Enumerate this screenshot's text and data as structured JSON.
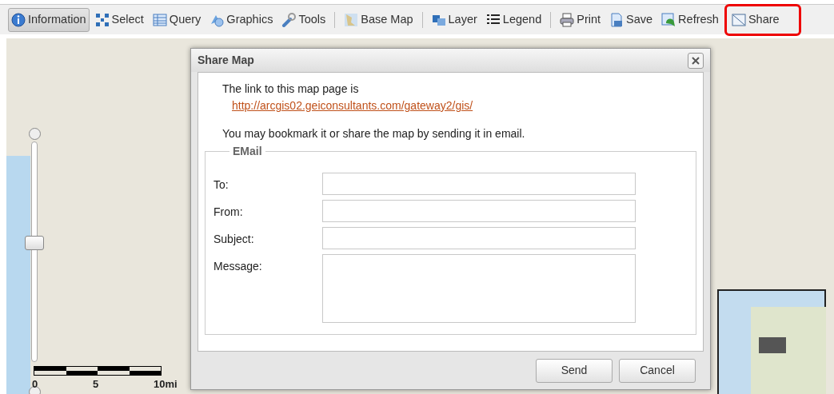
{
  "toolbar": [
    {
      "kind": "tool",
      "label": "Information",
      "selected": true
    },
    {
      "kind": "tool",
      "label": "Select",
      "selected": false
    },
    {
      "kind": "tool",
      "label": "Query",
      "selected": false
    },
    {
      "kind": "tool",
      "label": "Graphics",
      "selected": false
    },
    {
      "kind": "tool",
      "label": "Tools",
      "selected": false
    },
    {
      "kind": "separator"
    },
    {
      "kind": "tool",
      "label": "Base Map",
      "selected": false
    },
    {
      "kind": "separator"
    },
    {
      "kind": "tool",
      "label": "Layer",
      "selected": false
    },
    {
      "kind": "tool",
      "label": "Legend",
      "selected": false
    },
    {
      "kind": "separator"
    },
    {
      "kind": "tool",
      "label": "Print",
      "selected": false
    },
    {
      "kind": "tool",
      "label": "Save",
      "selected": false
    },
    {
      "kind": "tool",
      "label": "Refresh",
      "selected": false
    },
    {
      "kind": "tool",
      "label": "Share",
      "selected": false,
      "highlighted": true
    }
  ],
  "map": {
    "zoom_slider": {
      "level": 0.54
    },
    "scale_bar": [
      "0",
      "5",
      "10mi"
    ]
  },
  "dialog": {
    "title": "Share Map",
    "intro": "The link to this map page is",
    "link": "http://arcgis02.geiconsultants.com/gateway2/gis/",
    "note": "You may bookmark it or share the map by sending it in email.",
    "fieldset": "EMail",
    "fields": [
      {
        "kind": "input",
        "label": "To:"
      },
      {
        "kind": "input",
        "label": "From:"
      },
      {
        "kind": "input",
        "label": "Subject:"
      },
      {
        "kind": "textarea",
        "label": "Message:"
      }
    ],
    "buttons": [
      "Send",
      "Cancel"
    ]
  }
}
